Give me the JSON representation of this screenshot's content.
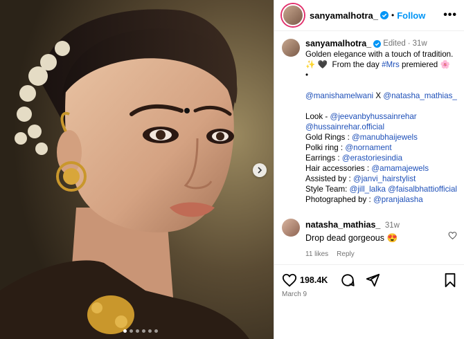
{
  "header": {
    "username": "sanyamalhotra_",
    "follow_label": "Follow",
    "more_label": "•••"
  },
  "caption": {
    "username": "sanyamalhotra_",
    "edited": "Edited",
    "age": "31w",
    "lines": [
      "Golden elegance with a touch of tradition.",
      "✨ 🖤  From the day #Mrs premiered 🌸",
      "•"
    ],
    "tags_line": "@manishamelwani X @natasha_mathias_",
    "credits": [
      {
        "label": "Look - ",
        "value": "@jeevanbyhussainrehar"
      },
      {
        "label": "",
        "value": "@hussainrehar.official"
      },
      {
        "label": "Gold Rings : ",
        "value": "@manubhaijewels"
      },
      {
        "label": "Polki ring : ",
        "value": "@nornament"
      },
      {
        "label": "Earrings : ",
        "value": "@erastoriesindia"
      },
      {
        "label": "Hair accessories : ",
        "value": "@amamajewels"
      },
      {
        "label": "Assisted by : ",
        "value": "@janvi_hairstylist"
      },
      {
        "label": "Style Team: ",
        "value": "@jill_lalka @faisalbhattiofficial"
      },
      {
        "label": "Photographed by : ",
        "value": "@pranjalasha"
      }
    ]
  },
  "comment": {
    "username": "natasha_mathias_",
    "age": "31w",
    "text": "Drop dead gorgeous 😍",
    "likes": "11 likes",
    "reply": "Reply"
  },
  "actions": {
    "likes_count": "198.4K",
    "date": "March 9"
  },
  "carousel": {
    "total": 6,
    "active": 0
  },
  "colors": {
    "link": "#1d4fb8",
    "follow": "#0095f6",
    "ring": "#e1306c",
    "verified": "#0095f6"
  },
  "icons": [
    "heart-icon",
    "comment-icon",
    "share-icon",
    "bookmark-icon",
    "chevron-right-icon",
    "verified-icon",
    "more-icon"
  ]
}
